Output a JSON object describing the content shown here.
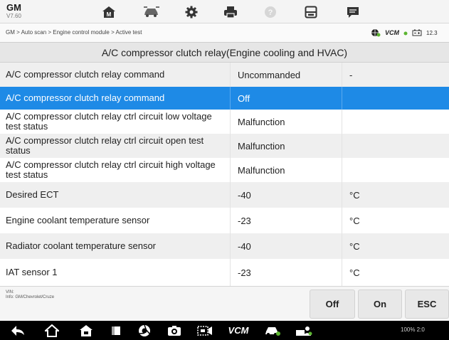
{
  "brand": {
    "name": "GM",
    "version": "V7.60"
  },
  "breadcrumb": "GM > Auto scan > Engine control module > Active test",
  "status": {
    "vcm": "VCM",
    "battery_voltage": "12.3"
  },
  "section_title": "A/C compressor clutch relay(Engine cooling and HVAC)",
  "rows": [
    {
      "name": "A/C compressor clutch relay command",
      "value": "Uncommanded",
      "unit": "-"
    },
    {
      "name": "A/C compressor clutch relay command",
      "value": "Off",
      "unit": "",
      "selected": true
    },
    {
      "name": "A/C compressor clutch relay ctrl circuit low voltage test status",
      "value": "Malfunction",
      "unit": ""
    },
    {
      "name": "A/C compressor clutch relay ctrl circuit open test status",
      "value": "Malfunction",
      "unit": ""
    },
    {
      "name": "A/C compressor clutch relay ctrl circuit high voltage test status",
      "value": "Malfunction",
      "unit": ""
    },
    {
      "name": "Desired ECT",
      "value": "-40",
      "unit": "°C"
    },
    {
      "name": "Engine coolant temperature sensor",
      "value": "-23",
      "unit": "°C"
    },
    {
      "name": "Radiator coolant temperature sensor",
      "value": "-40",
      "unit": "°C"
    },
    {
      "name": "IAT sensor 1",
      "value": "-23",
      "unit": "°C"
    }
  ],
  "footer": {
    "vin_label": "VIN:",
    "info_label": "Info: GM/Chevrolet/Cruze",
    "buttons": {
      "off": "Off",
      "on": "On",
      "esc": "ESC"
    }
  },
  "navbar": {
    "vcm": "VCM",
    "status_text": "100% 2:0"
  },
  "colors": {
    "selected_row": "#1e8ae6",
    "accent_green": "#5cb531",
    "toolbar_bg": "#f4f4f4"
  },
  "icons": [
    "home-icon",
    "vehicle-swap-icon",
    "settings-icon",
    "print-icon",
    "help-icon",
    "save-icon",
    "message-icon"
  ]
}
